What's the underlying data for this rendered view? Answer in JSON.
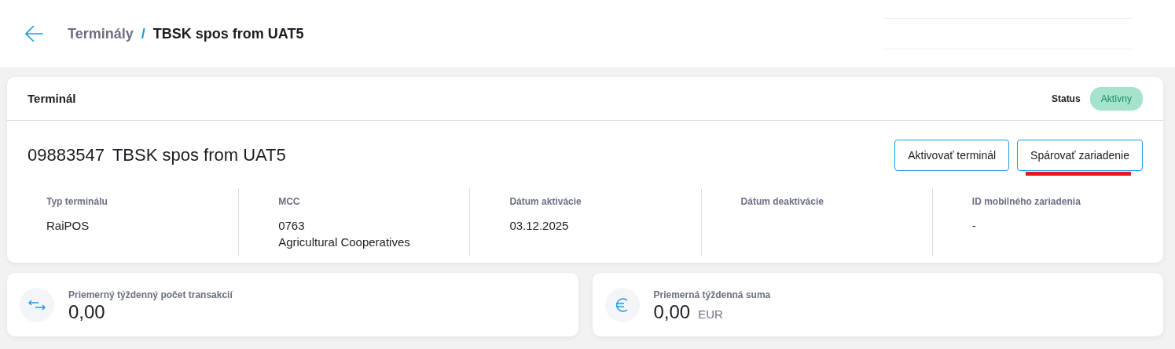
{
  "breadcrumb": {
    "parent": "Terminály",
    "separator": "/",
    "current": "TBSK spos from UAT5"
  },
  "terminal_card": {
    "title": "Terminál",
    "status_label": "Status",
    "status": {
      "text": "Aktívny",
      "kind": "active"
    },
    "heading_id": "09883547",
    "heading_name": "TBSK spos from UAT5",
    "buttons": [
      {
        "label": "Aktivovať terminál",
        "highlighted": false
      },
      {
        "label": "Spárovať zariadenie",
        "highlighted": true
      }
    ],
    "details": [
      {
        "label": "Typ terminálu",
        "lines": [
          "RaiPOS"
        ]
      },
      {
        "label": "MCC",
        "lines": [
          "0763",
          "Agricultural Cooperatives"
        ]
      },
      {
        "label": "Dátum aktivácie",
        "lines": [
          "03.12.2025"
        ]
      },
      {
        "label": "Dátum deaktivácie"
      },
      {
        "label": "ID mobilného zariadenia",
        "lines": [
          "-"
        ]
      }
    ]
  },
  "stats": [
    {
      "kind": "transactions",
      "label": "Priemerný týždenný počet transakcií",
      "value": "0,00"
    },
    {
      "kind": "amount",
      "label": "Priemerná týždenná suma",
      "value": "0,00",
      "unit": "EUR"
    }
  ]
}
